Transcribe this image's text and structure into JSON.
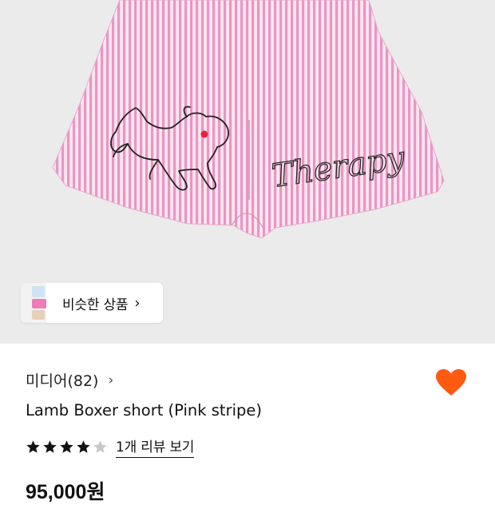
{
  "similar": {
    "label": "비슷한 상품",
    "arrow": "›"
  },
  "product": {
    "brand": "미디어(82)",
    "brand_chevron": "›",
    "name": "Lamb Boxer short (Pink stripe)",
    "rating": {
      "stars": 4,
      "max": 5
    },
    "review_link": "1개 리뷰 보기",
    "price": "95,000원",
    "liked": true
  },
  "embroidery_text": "Therapy",
  "colors": {
    "background": "#ebebeb",
    "stripe_pink": "#e58cbd",
    "heart": "#ff5a12",
    "star": "#111111",
    "star_empty": "#c8c8c8"
  }
}
